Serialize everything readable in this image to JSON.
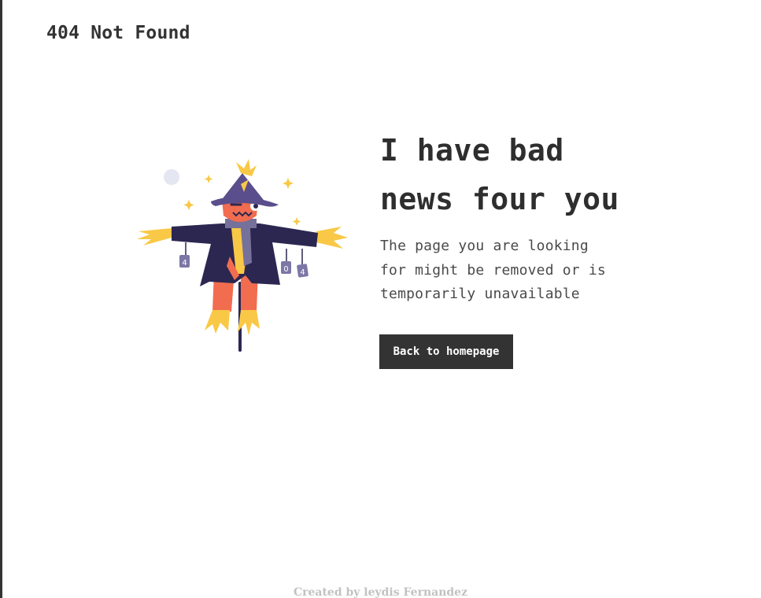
{
  "header": {
    "title": "404 Not Found"
  },
  "main": {
    "headline_line1": "I have bad",
    "headline_line2": "news four you",
    "message_line1": "The page you are looking",
    "message_line2": "for might be removed or is",
    "message_line3": "temporarily unavailable",
    "button_label": "Back to homepage"
  },
  "illustration": {
    "name": "scarecrow-illustration",
    "can_labels": [
      "4",
      "0",
      "4"
    ],
    "colors": {
      "coat": "#2c2751",
      "hat": "#5a4e8c",
      "face": "#f26c4f",
      "straw": "#f9c846",
      "scarf": "#76719a",
      "can": "#7c77a6",
      "pole": "#2c2751",
      "moon": "#e4e6f2"
    }
  },
  "footer": {
    "credit": "Created by leydis Fernandez"
  },
  "theme": {
    "text": "#333333",
    "button_bg": "#333333",
    "button_text": "#ffffff",
    "footer_text": "#c2c2c2"
  }
}
